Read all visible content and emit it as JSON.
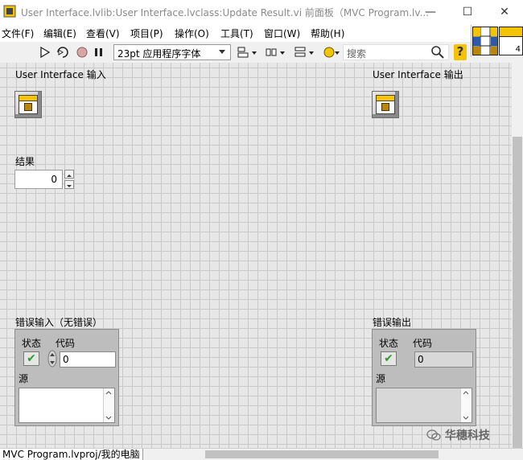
{
  "window": {
    "title": "User Interface.lvlib:User Interface.lvclass:Update Result.vi 前面板（MVC Program.lv...",
    "minimize": "—",
    "maximize": "☐",
    "close": "✕"
  },
  "menu": [
    "文件(F)",
    "编辑(E)",
    "查看(V)",
    "项目(P)",
    "操作(O)",
    "工具(T)",
    "窗口(W)",
    "帮助(H)"
  ],
  "toolbar": {
    "font": "23pt 应用程序字体",
    "search_placeholder": "搜索",
    "help_glyph": "?"
  },
  "connector": {
    "count": "4"
  },
  "controls": {
    "ui_in_label": "User Interface 输入",
    "ui_out_label": "User Interface 输出",
    "result_label": "结果",
    "result_value": "0"
  },
  "error_in": {
    "label": "错误输入（无错误）",
    "status_label": "状态",
    "code_label": "代码",
    "code_value": "0",
    "source_label": "源",
    "status_mark": "✔"
  },
  "error_out": {
    "label": "错误输出",
    "status_label": "状态",
    "code_label": "代码",
    "code_value": "0",
    "source_label": "源",
    "status_mark": "✔"
  },
  "statusbar": {
    "text": "MVC Program.lvproj/我的电脑"
  },
  "watermark": {
    "text": "华穗科技"
  },
  "colors": {
    "accent": "#f4c400",
    "check": "#2d9c2d"
  }
}
